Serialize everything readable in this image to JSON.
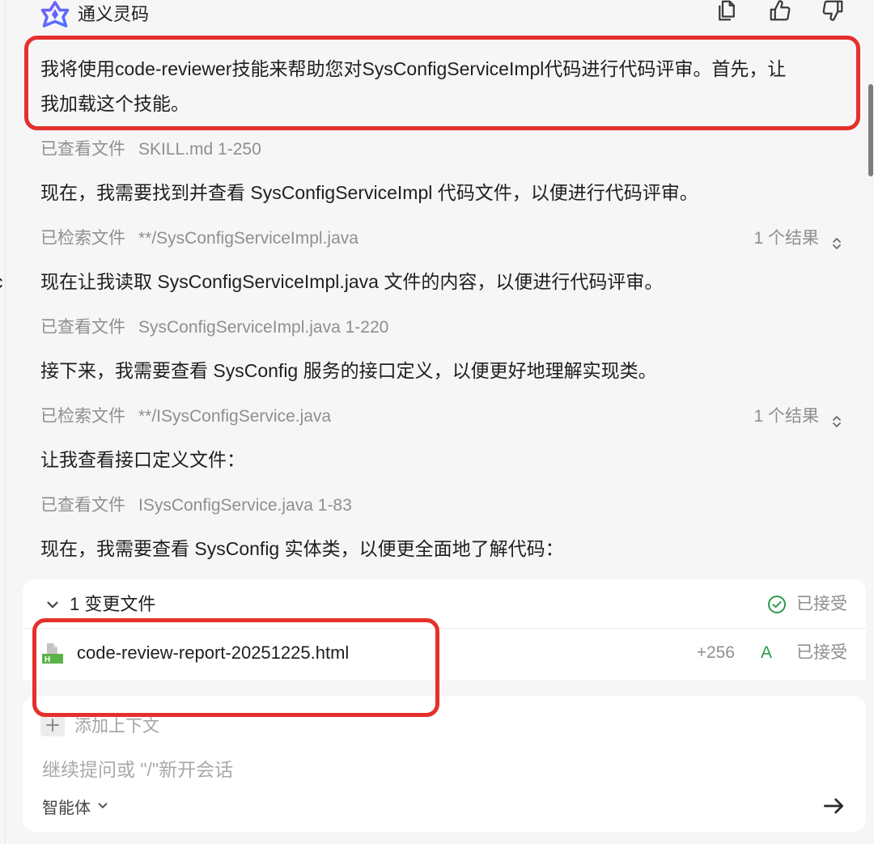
{
  "app": {
    "title": "通义灵码",
    "logo_icon": "tongyi-lingma-logo-icon"
  },
  "header_actions": [
    {
      "icon": "copy-icon"
    },
    {
      "icon": "thumbs-up-icon"
    },
    {
      "icon": "thumbs-down-icon"
    }
  ],
  "editor_edge_fragment": "c",
  "conversation": [
    {
      "highlighted": true,
      "lines": [
        "我将使用code-reviewer技能来帮助您对SysConfigServiceImpl代码进行代码评审。首先，让",
        "我加载这个技能。"
      ]
    },
    {
      "action": "已查看文件",
      "target": "SKILL.md 1-250"
    },
    {
      "text": "现在，我需要找到并查看 SysConfigServiceImpl 代码文件，以便进行代码评审。"
    },
    {
      "action": "已检索文件",
      "target": "**/SysConfigServiceImpl.java",
      "result": "1 个结果",
      "result_icon": "chevron-up-down-icon"
    },
    {
      "text": "现在让我读取 SysConfigServiceImpl.java 文件的内容，以便进行代码评审。"
    },
    {
      "action": "已查看文件",
      "target": "SysConfigServiceImpl.java 1-220"
    },
    {
      "text": "接下来，我需要查看 SysConfig 服务的接口定义，以便更好地理解实现类。"
    },
    {
      "action": "已检索文件",
      "target": "**/ISysConfigService.java",
      "result": "1 个结果",
      "result_icon": "chevron-up-down-icon"
    },
    {
      "text": "让我查看接口定义文件："
    },
    {
      "action": "已查看文件",
      "target": "ISysConfigService.java 1-83"
    },
    {
      "text": "现在，我需要查看 SysConfig 实体类，以便更全面地了解代码："
    }
  ],
  "changes": {
    "expanded": true,
    "toggle_icon": "chevron-down-icon",
    "title": "1 变更文件",
    "status": "已接受",
    "status_icon": "check-circle-icon",
    "files": [
      {
        "icon": "html-file-icon",
        "icon_letter": "H",
        "name": "code-review-report-20251225.html",
        "additions": "+256",
        "change_type": "A",
        "status": "已接受",
        "highlighted": true
      }
    ]
  },
  "input": {
    "add_context_icon": "plus-icon",
    "add_context": "添加上下文",
    "placeholder": "继续提问或 \"/\"新开会话",
    "mode": "智能体",
    "mode_icon": "chevron-down-icon",
    "send_icon": "arrow-right-icon"
  },
  "theme": {
    "bg": "#f6f6f7",
    "card": "#ffffff",
    "text": "#1f1f1f",
    "muted": "#8f8f8f",
    "accent_red": "#e5302b",
    "success_green": "#2b9a48"
  }
}
